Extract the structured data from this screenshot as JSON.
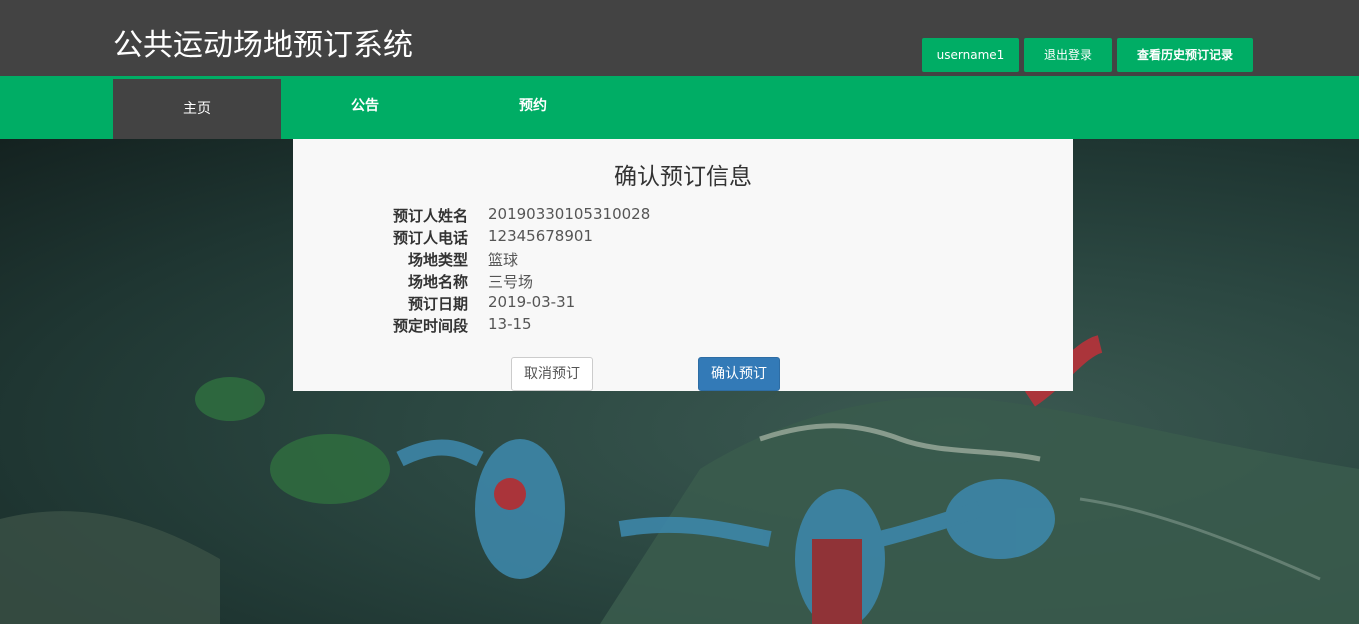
{
  "header": {
    "site_title": "公共运动场地预订系统",
    "username": "username1",
    "logout_label": "退出登录",
    "history_label": "查看历史预订记录"
  },
  "nav": {
    "home": "主页",
    "notice": "公告",
    "reserve": "预约"
  },
  "confirm": {
    "title": "确认预订信息",
    "fields": [
      {
        "label": "预订人姓名",
        "value": "20190330105310028"
      },
      {
        "label": "预订人电话",
        "value": "12345678901"
      },
      {
        "label": "场地类型",
        "value": "篮球"
      },
      {
        "label": "场地名称",
        "value": "三号场"
      },
      {
        "label": "预订日期",
        "value": "2019-03-31"
      },
      {
        "label": "预定时间段",
        "value": "13-15"
      }
    ],
    "cancel_label": "取消预订",
    "confirm_label": "确认预订"
  },
  "colors": {
    "topbar": "#434343",
    "brand_green": "#00ad65",
    "primary_blue": "#337ab7"
  }
}
